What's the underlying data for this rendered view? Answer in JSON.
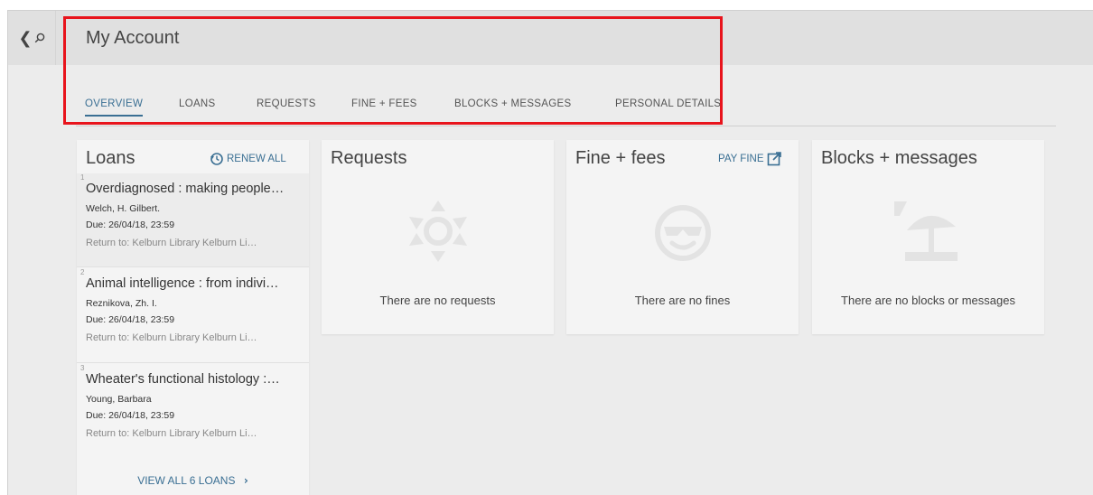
{
  "header": {
    "page_title": "My Account",
    "back_icon": "chevron-left-icon",
    "search_icon": "search-icon"
  },
  "tabs": [
    {
      "label": "OVERVIEW",
      "active": true
    },
    {
      "label": "LOANS",
      "active": false
    },
    {
      "label": "REQUESTS",
      "active": false
    },
    {
      "label": "FINE + FEES",
      "active": false
    },
    {
      "label": "BLOCKS + MESSAGES",
      "active": false
    },
    {
      "label": "PERSONAL DETAILS",
      "active": false
    }
  ],
  "loans": {
    "title": "Loans",
    "renew_all_label": "RENEW ALL",
    "items": [
      {
        "num": "1",
        "title": "Overdiagnosed : making people…",
        "author": "Welch, H. Gilbert.",
        "due": "Due: 26/04/18, 23:59",
        "return_to": "Return to: Kelburn Library Kelburn Li…"
      },
      {
        "num": "2",
        "title": "Animal intelligence : from indivi…",
        "author": "Reznikova, Zh. I.",
        "due": "Due: 26/04/18, 23:59",
        "return_to": "Return to: Kelburn Library Kelburn Li…"
      },
      {
        "num": "3",
        "title": "Wheater's functional histology :…",
        "author": "Young, Barbara",
        "due": "Due: 26/04/18, 23:59",
        "return_to": "Return to: Kelburn Library Kelburn Li…"
      }
    ],
    "view_all_label": "VIEW ALL 6 LOANS",
    "view_all_icon": "chevron-right-icon"
  },
  "requests": {
    "title": "Requests",
    "empty_message": "There are no requests",
    "icon": "sun-icon"
  },
  "fines": {
    "title": "Fine + fees",
    "pay_fine_label": "PAY FINE",
    "pay_fine_icon": "external-link-icon",
    "empty_message": "There are no fines",
    "icon": "sunglasses-face-icon"
  },
  "blocks": {
    "title": "Blocks + messages",
    "empty_message": "There are no blocks or messages",
    "icon": "beach-umbrella-icon"
  },
  "colors": {
    "accent": "#3a6f93",
    "highlight": "#e8141c",
    "background": "#ececec"
  }
}
